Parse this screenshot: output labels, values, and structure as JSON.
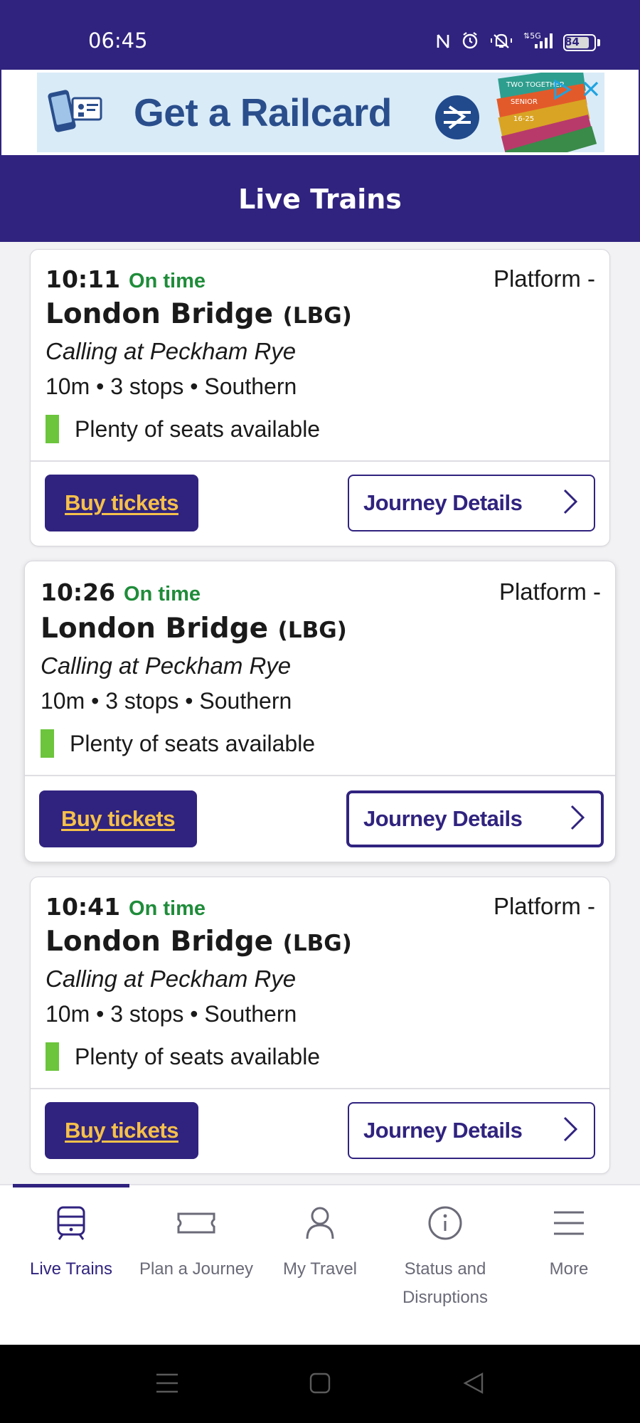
{
  "status_bar": {
    "time": "06:45",
    "battery": "84",
    "battery_level": 0.84,
    "icons": [
      "nfc-icon",
      "alarm-icon",
      "vibrate-icon",
      "5g-signal-icon",
      "battery-icon"
    ]
  },
  "ad": {
    "text": "Get a Railcard",
    "card_lines": [
      "TWO TOGETHER",
      "SENIOR",
      "16-25"
    ]
  },
  "header": {
    "title": "Live Trains"
  },
  "trains": [
    {
      "time": "10:11",
      "status": "On time",
      "platform": "Platform -",
      "destination": "London Bridge",
      "code": "(LBG)",
      "calling": "Calling at Peckham Rye",
      "meta": "10m • 3 stops • Southern",
      "seats": "Plenty of seats available",
      "buy_label": "Buy tickets",
      "details_label": "Journey Details"
    },
    {
      "time": "10:26",
      "status": "On time",
      "platform": "Platform -",
      "destination": "London Bridge",
      "code": "(LBG)",
      "calling": "Calling at Peckham Rye",
      "meta": "10m • 3 stops • Southern",
      "seats": "Plenty of seats available",
      "buy_label": "Buy tickets",
      "details_label": "Journey Details"
    },
    {
      "time": "10:41",
      "status": "On time",
      "platform": "Platform -",
      "destination": "London Bridge",
      "code": "(LBG)",
      "calling": "Calling at Peckham Rye",
      "meta": "10m • 3 stops • Southern",
      "seats": "Plenty of seats available",
      "buy_label": "Buy tickets",
      "details_label": "Journey Details"
    }
  ],
  "nav": {
    "items": [
      {
        "label": "Live Trains",
        "icon": "train-icon",
        "active": true
      },
      {
        "label": "Plan a Journey",
        "icon": "ticket-icon",
        "active": false
      },
      {
        "label": "My Travel",
        "icon": "person-icon",
        "active": false
      },
      {
        "label": "Status and Disruptions",
        "icon": "info-icon",
        "active": false
      },
      {
        "label": "More",
        "icon": "menu-icon",
        "active": false
      }
    ]
  },
  "colors": {
    "brand": "#30237f",
    "on_time": "#1f8c3a",
    "buy_text": "#f6c04a",
    "seats_indicator": "#6cc53c"
  }
}
